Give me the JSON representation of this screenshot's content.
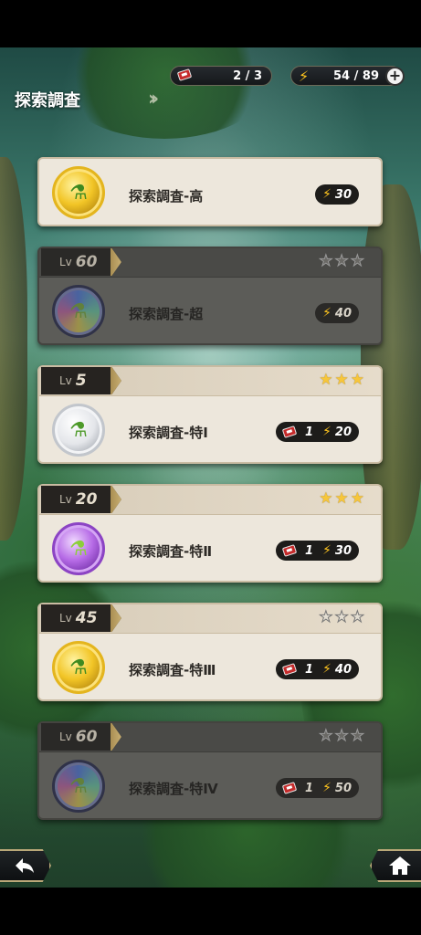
{
  "header": {
    "title": "探索調査",
    "tickets": "2 / 3",
    "energy": "54 / 89",
    "plus_icon": "plus-icon"
  },
  "stages": [
    {
      "level": "",
      "name": "探索調査-高",
      "stars": 0,
      "locked": false,
      "show_header": false,
      "orb": "gold",
      "tickets": "",
      "energy": "30"
    },
    {
      "level": "60",
      "name": "探索調査-超",
      "stars": 0,
      "locked": true,
      "show_header": true,
      "orb": "rainbow",
      "tickets": "",
      "energy": "40"
    },
    {
      "level": "5",
      "name": "探索調査-特Ⅰ",
      "stars": 3,
      "locked": false,
      "show_header": true,
      "orb": "silver",
      "tickets": "1",
      "energy": "20"
    },
    {
      "level": "20",
      "name": "探索調査-特Ⅱ",
      "stars": 3,
      "locked": false,
      "show_header": true,
      "orb": "purple",
      "tickets": "1",
      "energy": "30"
    },
    {
      "level": "45",
      "name": "探索調査-特Ⅲ",
      "stars": 0,
      "locked": false,
      "show_header": true,
      "orb": "gold",
      "tickets": "1",
      "energy": "40"
    },
    {
      "level": "60",
      "name": "探索調査-特Ⅳ",
      "stars": 0,
      "locked": true,
      "show_header": true,
      "orb": "rainbow",
      "tickets": "1",
      "energy": "50"
    }
  ],
  "labels": {
    "lv": "Lv"
  },
  "colors": {
    "star_on": "#f7c63a",
    "energy": "#ffc51e",
    "ticket": "#c52b2b"
  },
  "footer": {
    "back_icon": "back-arrow-icon",
    "home_icon": "home-icon"
  }
}
